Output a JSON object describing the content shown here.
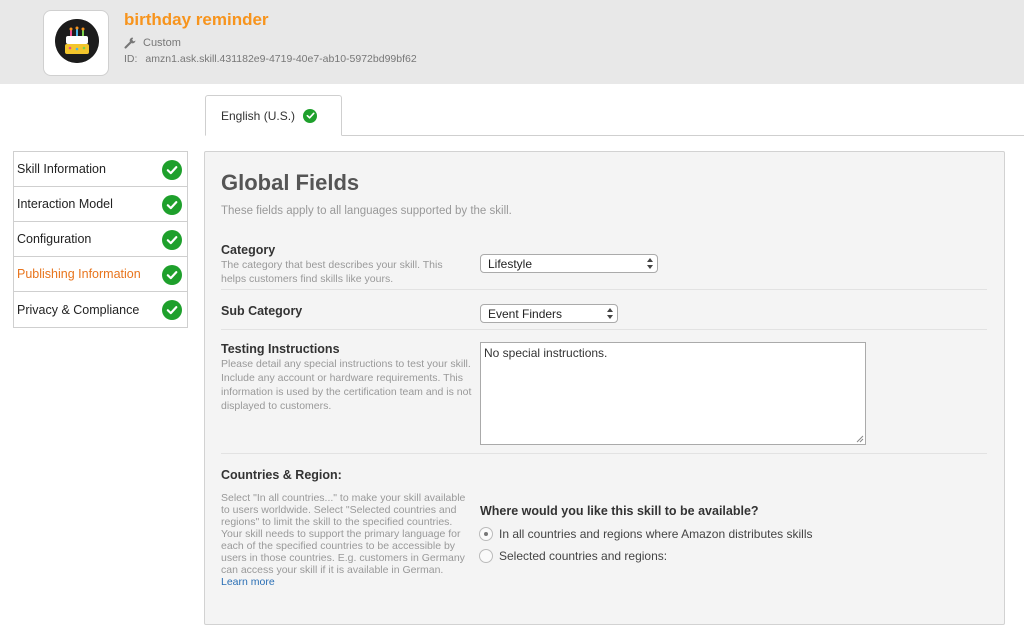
{
  "header": {
    "app_name": "birthday reminder",
    "skill_type": "Custom",
    "id_label": "ID:",
    "skill_id": "amzn1.ask.skill.431182e9-4719-40e7-ab10-5972bd99bf62",
    "logo_text": "Birthday"
  },
  "tabs": [
    {
      "label": "English (U.S.)",
      "complete": true
    }
  ],
  "sidebar": {
    "items": [
      {
        "label": "Skill Information",
        "complete": true
      },
      {
        "label": "Interaction Model",
        "complete": true
      },
      {
        "label": "Configuration",
        "complete": true
      },
      {
        "label": "Publishing Information",
        "complete": true,
        "active": true
      },
      {
        "label": "Privacy & Compliance",
        "complete": true
      }
    ]
  },
  "main": {
    "title": "Global Fields",
    "subtitle": "These fields apply to all languages supported by the skill.",
    "category": {
      "label": "Category",
      "description": "The category that best describes your skill. This helps customers find skills like yours.",
      "value": "Lifestyle"
    },
    "sub_category": {
      "label": "Sub Category",
      "value": "Event Finders"
    },
    "testing": {
      "label": "Testing Instructions",
      "description": "Please detail any special instructions to test your skill. Include any account or hardware requirements. This information is used by the certification team and is not displayed to customers.",
      "value": "No special instructions."
    },
    "countries": {
      "label": "Countries & Region:",
      "description": "Select \"In all countries...\" to make your skill available to users worldwide. Select \"Selected countries and regions\" to limit the skill to the specified countries.",
      "description2": "Your skill needs to support the primary language for each of the specified countries to be accessible by users in those countries. E.g. customers in Germany can access your skill if it is available in German.",
      "learn_more": "Learn more",
      "question": "Where would you like this skill to be available?",
      "options": [
        {
          "label": "In all countries and regions where Amazon distributes skills",
          "selected": true
        },
        {
          "label": "Selected countries and regions:",
          "selected": false
        }
      ]
    }
  },
  "colors": {
    "accent": "#f7941d",
    "active_nav": "#e8741c",
    "success": "#1ea02c",
    "link": "#2a6fb5"
  }
}
